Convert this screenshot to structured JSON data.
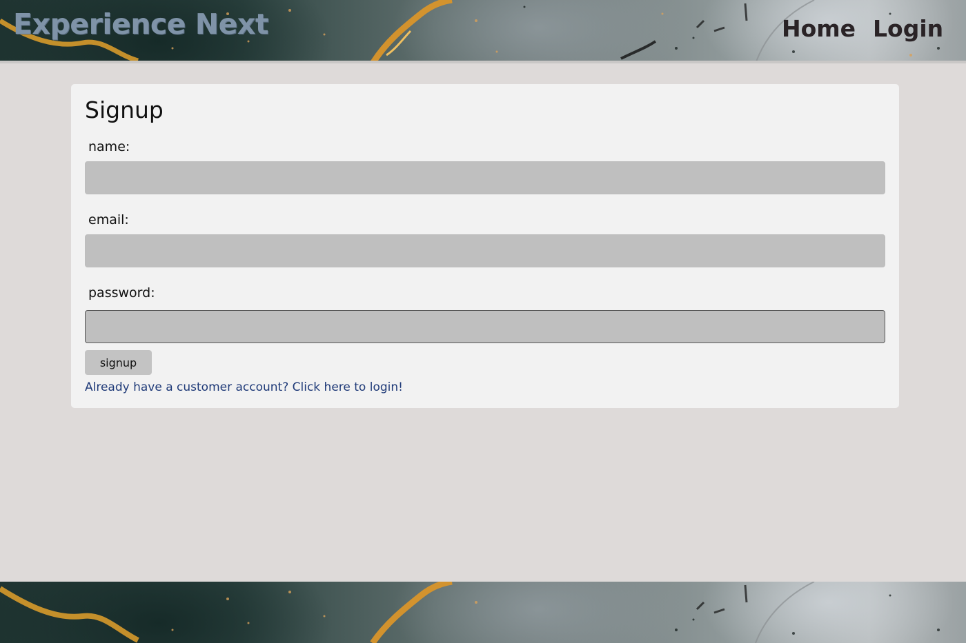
{
  "header": {
    "brand": "Experience Next",
    "nav": [
      {
        "label": "Home"
      },
      {
        "label": "Login"
      }
    ]
  },
  "form": {
    "title": "Signup",
    "name_label": "name:",
    "name_value": "",
    "email_label": "email:",
    "email_value": "",
    "password_label": "password:",
    "password_value": "",
    "submit_label": "signup",
    "login_link": "Already have a customer account? Click here to login!"
  },
  "colors": {
    "page_bg": "#dedad9",
    "card_bg": "#f2f2f2",
    "input_bg": "#bfbfbf",
    "brand_text": "#7f93a8",
    "link": "#1f3a78"
  }
}
